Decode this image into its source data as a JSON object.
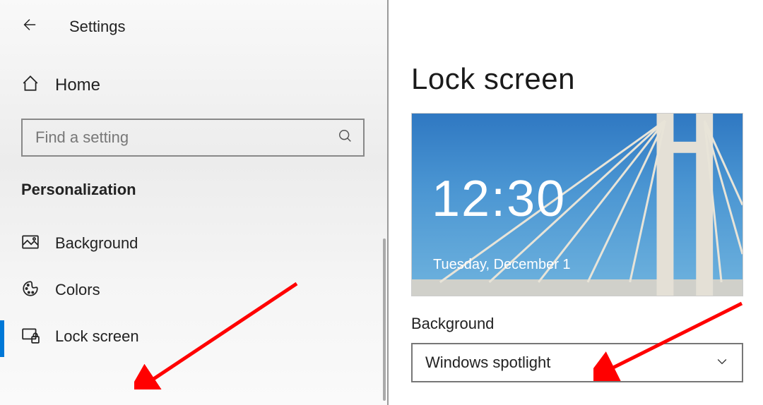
{
  "header": {
    "app_title": "Settings"
  },
  "sidebar": {
    "home_label": "Home",
    "search_placeholder": "Find a setting",
    "section_label": "Personalization",
    "items": [
      {
        "label": "Background"
      },
      {
        "label": "Colors"
      },
      {
        "label": "Lock screen"
      }
    ]
  },
  "main": {
    "page_title": "Lock screen",
    "preview_time": "12:30",
    "preview_date": "Tuesday, December 1",
    "background_label": "Background",
    "dropdown_value": "Windows spotlight"
  }
}
